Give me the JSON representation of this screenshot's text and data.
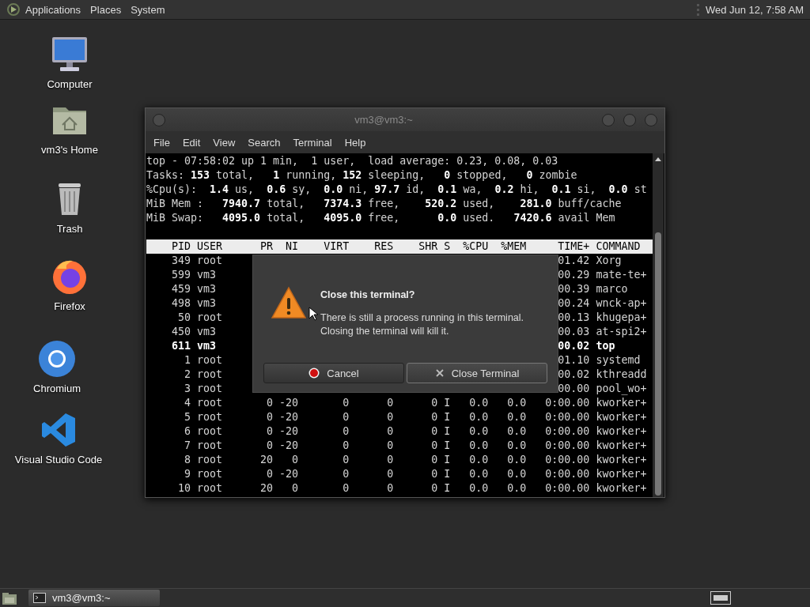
{
  "top_panel": {
    "menus": [
      "Applications",
      "Places",
      "System"
    ],
    "clock": "Wed Jun 12, 7:58 AM"
  },
  "desktop_icons": [
    {
      "label": "Computer",
      "kind": "computer"
    },
    {
      "label": "vm3's Home",
      "kind": "home"
    },
    {
      "label": "Trash",
      "kind": "trash"
    },
    {
      "label": "Firefox",
      "kind": "firefox"
    },
    {
      "label": "Chromium",
      "kind": "chromium"
    },
    {
      "label": "Visual Studio Code",
      "kind": "vscode"
    }
  ],
  "terminal": {
    "title": "vm3@vm3:~",
    "menu": [
      "File",
      "Edit",
      "View",
      "Search",
      "Terminal",
      "Help"
    ],
    "summary": [
      "top - 07:58:02 up 1 min,  1 user,  load average: 0.23, 0.08, 0.03",
      "Tasks: **153** total,   **1** running, **152** sleeping,   **0** stopped,   **0** zombie",
      "%Cpu(s):  **1.4** us,  **0.6** sy,  **0.0** ni, **97.7** id,  **0.1** wa,  **0.2** hi,  **0.1** si,  **0.0** st",
      "MiB Mem :   **7940.7** total,   **7374.3** free,    **520.2** used,    **281.0** buff/cache",
      "MiB Swap:   **4095.0** total,   **4095.0** free,      **0.0** used.   **7420.6** avail Mem"
    ],
    "header": "    PID USER      PR  NI    VIRT    RES    SHR S  %CPU  %MEM     TIME+ COMMAND",
    "rows": [
      {
        "left": "    349 root",
        "right": "01.42 Xorg",
        "bold": false
      },
      {
        "left": "    599 vm3",
        "right": "00.29 mate-te+",
        "bold": false
      },
      {
        "left": "    459 vm3",
        "right": "00.39 marco",
        "bold": false
      },
      {
        "left": "    498 vm3",
        "right": "00.24 wnck-ap+",
        "bold": false
      },
      {
        "left": "     50 root",
        "right": "00.13 khugepa+",
        "bold": false
      },
      {
        "left": "    450 vm3",
        "right": "00.03 at-spi2+",
        "bold": false
      },
      {
        "left": "    611 vm3",
        "right": "00.02 top",
        "bold": true
      },
      {
        "left": "      1 root",
        "right": "01.10 systemd",
        "bold": false
      },
      {
        "left": "      2 root",
        "right": "00.02 kthreadd",
        "bold": false
      },
      {
        "left": "      3 root",
        "right": "00.00 pool_wo+",
        "bold": false
      },
      {
        "text": "      4 root       0 -20       0      0      0 I   0.0   0.0   0:00.00 kworker+",
        "bold": false
      },
      {
        "text": "      5 root       0 -20       0      0      0 I   0.0   0.0   0:00.00 kworker+",
        "bold": false
      },
      {
        "text": "      6 root       0 -20       0      0      0 I   0.0   0.0   0:00.00 kworker+",
        "bold": false
      },
      {
        "text": "      7 root       0 -20       0      0      0 I   0.0   0.0   0:00.00 kworker+",
        "bold": false
      },
      {
        "text": "      8 root      20   0       0      0      0 I   0.0   0.0   0:00.00 kworker+",
        "bold": false
      },
      {
        "text": "      9 root       0 -20       0      0      0 I   0.0   0.0   0:00.00 kworker+",
        "bold": false
      },
      {
        "text": "     10 root      20   0       0      0      0 I   0.0   0.0   0:00.00 kworker+",
        "bold": false
      }
    ]
  },
  "dialog": {
    "title": "Close this terminal?",
    "message": "There is still a process running in this terminal.\nClosing the terminal will kill it.",
    "buttons": [
      {
        "label": "Cancel",
        "kind": "cancel",
        "focused": false
      },
      {
        "label": "Close Terminal",
        "kind": "close",
        "focused": true
      }
    ]
  },
  "taskbar": {
    "tasks": [
      {
        "label": "vm3@vm3:~",
        "selected": true
      }
    ]
  }
}
